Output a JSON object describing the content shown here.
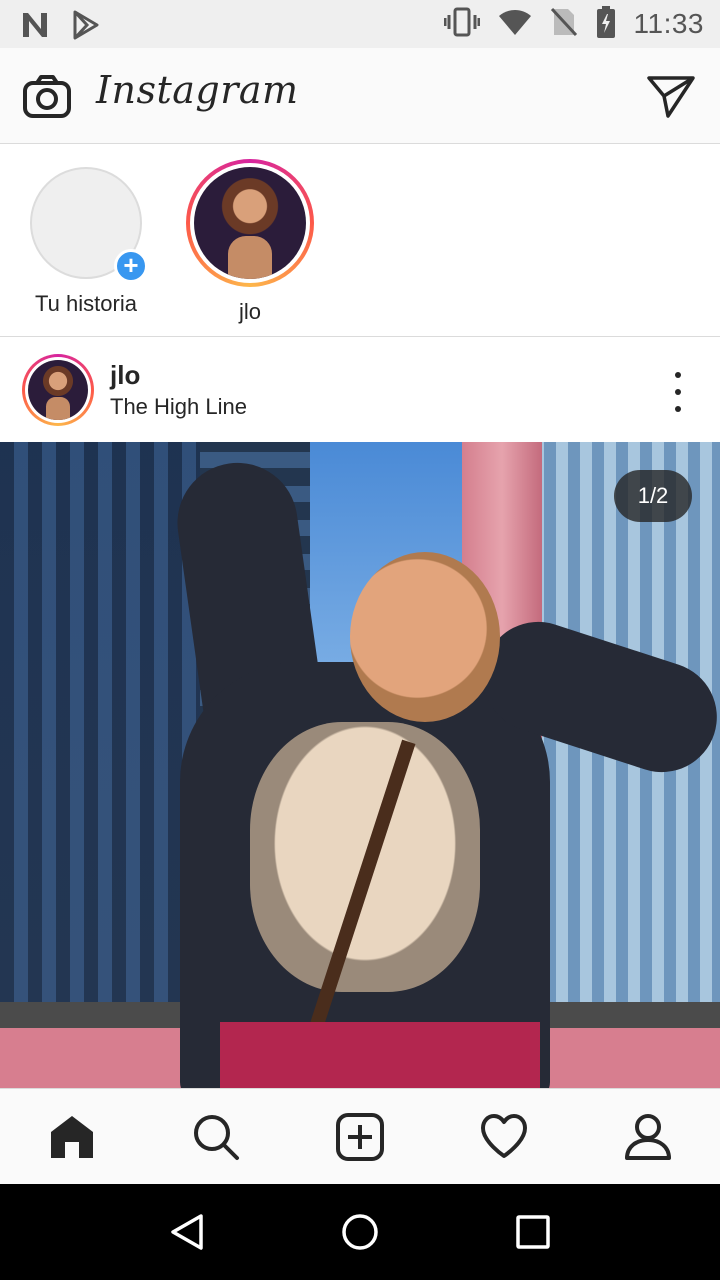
{
  "status_bar": {
    "time": "11:33",
    "icons": [
      "n-notification-icon",
      "play-store-icon",
      "vibrate-icon",
      "wifi-icon",
      "no-sim-icon",
      "battery-icon"
    ]
  },
  "header": {
    "app_name": "Instagram",
    "camera_icon": "camera-icon",
    "direct_icon": "paper-plane-icon"
  },
  "stories": [
    {
      "label": "Tu historia",
      "type": "own"
    },
    {
      "label": "jlo",
      "type": "user"
    }
  ],
  "post": {
    "username": "jlo",
    "location": "The High Line",
    "slide_indicator": "1/2"
  },
  "bottom_nav": [
    "home-icon",
    "search-icon",
    "add-post-icon",
    "activity-heart-icon",
    "profile-icon"
  ],
  "colors": {
    "story_gradient": [
      "#d6249f",
      "#fd5949",
      "#fdb74b"
    ],
    "add_badge": "#3897f0"
  }
}
